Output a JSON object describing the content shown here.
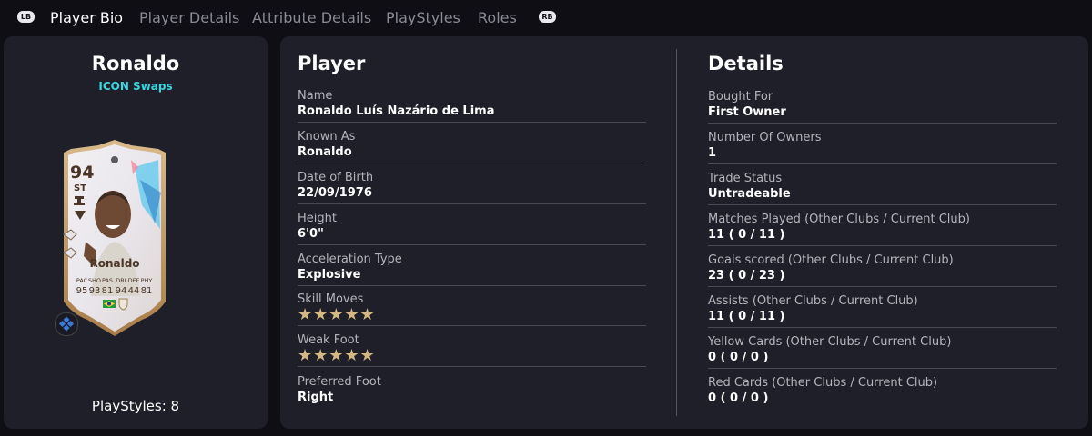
{
  "nav": {
    "left_bumper": "LB",
    "right_bumper": "RB",
    "tabs": [
      "Player Bio",
      "Player Details",
      "Attribute Details",
      "PlayStyles",
      "Roles"
    ],
    "active_tab": "Player Bio"
  },
  "summary": {
    "name": "Ronaldo",
    "version": "ICON Swaps",
    "version_color": "#3ad7e0",
    "playstyles_label": "PlayStyles: 8"
  },
  "card": {
    "rating": "94",
    "position": "ST",
    "name": "Ronaldo",
    "stats": [
      {
        "label": "PAC",
        "value": "95"
      },
      {
        "label": "SHO",
        "value": "93"
      },
      {
        "label": "PAS",
        "value": "81"
      },
      {
        "label": "DRI",
        "value": "94"
      },
      {
        "label": "DEF",
        "value": "44"
      },
      {
        "label": "PHY",
        "value": "81"
      }
    ],
    "nation_icon": "brazil-flag-icon",
    "club_icon": "icons-club-badge-icon",
    "evolution_icon": "evolution-badge-icon"
  },
  "player": {
    "title": "Player",
    "fields": [
      {
        "label": "Name",
        "value": "Ronaldo Luís Nazário de Lima"
      },
      {
        "label": "Known As",
        "value": "Ronaldo"
      },
      {
        "label": "Date of Birth",
        "value": "22/09/1976"
      },
      {
        "label": "Height",
        "value": "6'0\""
      },
      {
        "label": "Acceleration Type",
        "value": "Explosive"
      },
      {
        "label": "Skill Moves",
        "stars": 5
      },
      {
        "label": "Weak Foot",
        "stars": 5
      },
      {
        "label": "Preferred Foot",
        "value": "Right"
      }
    ]
  },
  "details": {
    "title": "Details",
    "fields": [
      {
        "label": "Bought For",
        "value": "First Owner"
      },
      {
        "label": "Number Of Owners",
        "value": "1"
      },
      {
        "label": "Trade Status",
        "value": "Untradeable"
      },
      {
        "label": "Matches Played (Other Clubs / Current Club)",
        "value": "11 ( 0 / 11 )"
      },
      {
        "label": "Goals scored (Other Clubs / Current Club)",
        "value": "23 ( 0 / 23 )"
      },
      {
        "label": "Assists (Other Clubs / Current Club)",
        "value": "11 ( 0 / 11 )"
      },
      {
        "label": "Yellow Cards (Other Clubs / Current Club)",
        "value": "0 ( 0 / 0 )"
      },
      {
        "label": "Red Cards (Other Clubs / Current Club)",
        "value": "0 ( 0 / 0 )"
      }
    ]
  },
  "colors": {
    "background": "#0e0e14",
    "panel": "#1f1f29",
    "star": "#d3b884",
    "accent": "#3ad7e0"
  }
}
